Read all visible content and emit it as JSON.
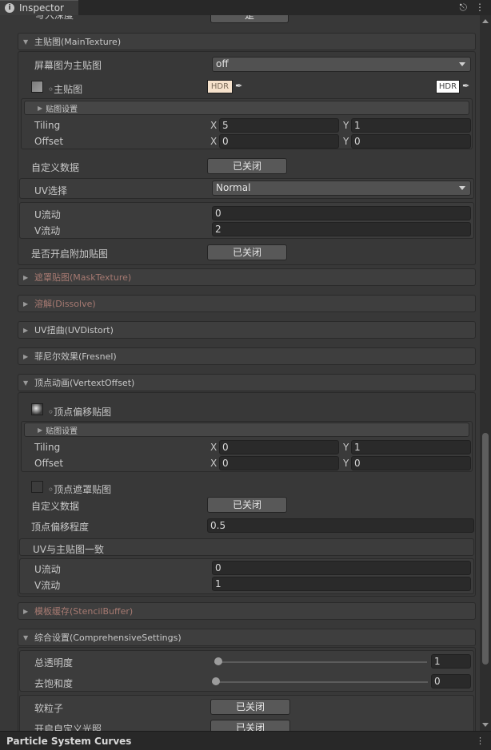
{
  "tab": {
    "title": "Inspector",
    "icon": "info-icon",
    "lock": "🔒",
    "menu": "⋮"
  },
  "top_partial": {
    "label": "写入深度",
    "button": "是"
  },
  "main_texture": {
    "title": "主贴图(MainTexture)",
    "screen_as_main_label": "屏幕图为主贴图",
    "screen_as_main_value": "off",
    "texture_label": "◦主贴图",
    "hdr1": "HDR",
    "hdr2": "HDR",
    "tex_settings": "贴图设置",
    "tiling_label": "Tiling",
    "offset_label": "Offset",
    "tiling_x": "5",
    "tiling_y": "1",
    "offset_x": "0",
    "offset_y": "0",
    "custom_data_label": "自定义数据",
    "custom_data_btn": "已关闭",
    "uv_select_label": "UV选择",
    "uv_select_value": "Normal",
    "u_flow_label": "U流动",
    "u_flow_value": "0",
    "v_flow_label": "V流动",
    "v_flow_value": "2",
    "extra_tex_label": "是否开启附加贴图",
    "extra_tex_btn": "已关闭"
  },
  "sections_collapsed": {
    "mask": "遮罩贴图(MaskTexture)",
    "dissolve": "溶解(Dissolve)",
    "uvdistort": "UV扭曲(UVDistort)",
    "fresnel": "菲尼尔效果(Fresnel)"
  },
  "vertex": {
    "title": "顶点动画(VertextOffset)",
    "offset_tex_label": "◦顶点偏移贴图",
    "tex_settings": "贴图设置",
    "tiling_label": "Tiling",
    "offset_label": "Offset",
    "tiling_x": "0",
    "tiling_y": "1",
    "offset_x": "0",
    "offset_y": "0",
    "mask_tex_label": "◦顶点遮罩贴图",
    "custom_data_label": "自定义数据",
    "custom_data_btn": "已关闭",
    "strength_label": "顶点偏移程度",
    "strength_value": "0.5",
    "uv_same_label": "UV与主贴图一致",
    "u_flow_label": "U流动",
    "u_flow_value": "0",
    "v_flow_label": "V流动",
    "v_flow_value": "1"
  },
  "stencil": {
    "title": "模板缓存(StencilBuffer)"
  },
  "comprehensive": {
    "title": "综合设置(ComprehensiveSettings)",
    "alpha_label": "总透明度",
    "alpha_value": "1",
    "alpha_level": 0.0,
    "desat_label": "去饱和度",
    "desat_value": "0",
    "desat_level": 0.0,
    "soft_particle_label": "软粒子",
    "soft_particle_btn": "已关闭",
    "custom_light_label": "开启自定义光照",
    "custom_light_btn": "已关闭"
  },
  "axes": {
    "x": "X",
    "y": "Y"
  },
  "bottom": {
    "title": "Particle System Curves",
    "menu": "⋮"
  },
  "colors": {
    "background": "#383838",
    "field": "#2a2a2a",
    "button": "#585858",
    "disabled_title": "#a77a72"
  }
}
